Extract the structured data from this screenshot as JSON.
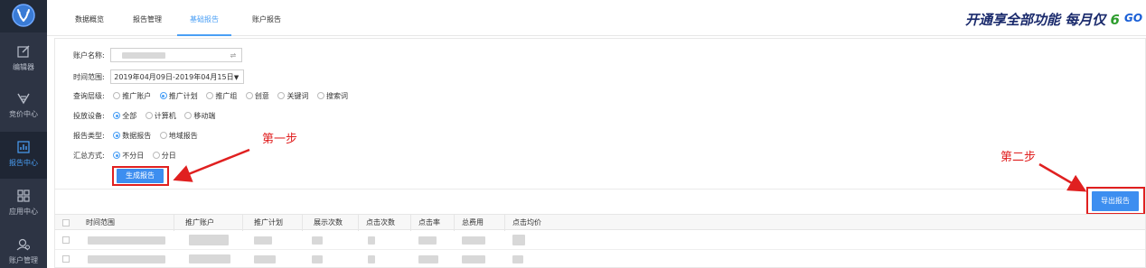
{
  "sidebar": {
    "logo_icon": "antler-logo-icon",
    "items": [
      {
        "label": "编辑器",
        "icon": "edit-icon",
        "active": false
      },
      {
        "label": "竞价中心",
        "icon": "bid-icon",
        "active": false
      },
      {
        "label": "报告中心",
        "icon": "report-icon",
        "active": true
      },
      {
        "label": "应用中心",
        "icon": "apps-icon",
        "active": false
      },
      {
        "label": "账户管理",
        "icon": "account-icon",
        "active": false
      }
    ]
  },
  "tabs": [
    {
      "label": "数据概览",
      "active": false
    },
    {
      "label": "报告管理",
      "active": false
    },
    {
      "label": "基础报告",
      "active": true
    },
    {
      "label": "账户报告",
      "active": false
    }
  ],
  "promo": {
    "text": "开通享全部功能 每月仅",
    "price": "66",
    "go": "GO"
  },
  "form": {
    "account": {
      "label": "账户名称:",
      "value": "",
      "swap_icon": "⇌"
    },
    "date_range": {
      "label": "时间范围:",
      "value": "2019年04月09日-2019年04月15日"
    },
    "level": {
      "label": "查询层级:",
      "options": [
        "推广账户",
        "推广计划",
        "推广组",
        "创意",
        "关键词",
        "搜索词"
      ],
      "selected": 1
    },
    "device": {
      "label": "投放设备:",
      "options": [
        "全部",
        "计算机",
        "移动端"
      ],
      "selected": 0
    },
    "report_type": {
      "label": "报告类型:",
      "options": [
        "数据报告",
        "地域报告"
      ],
      "selected": 0
    },
    "summary": {
      "label": "汇总方式:",
      "options": [
        "不分日",
        "分日"
      ],
      "selected": 0
    },
    "generate_label": "生成报告"
  },
  "export_label": "导出报告",
  "table": {
    "columns": [
      "时间范围",
      "推广账户",
      "推广计划",
      "展示次数",
      "点击次数",
      "点击率",
      "总费用",
      "点击均价"
    ]
  },
  "annotations": {
    "step1": "第一步",
    "step2": "第二步",
    "color": "#e02020"
  },
  "colors": {
    "accent": "#4a9ff5",
    "button": "#3d8ef0",
    "sidebar": "#2d3444"
  }
}
